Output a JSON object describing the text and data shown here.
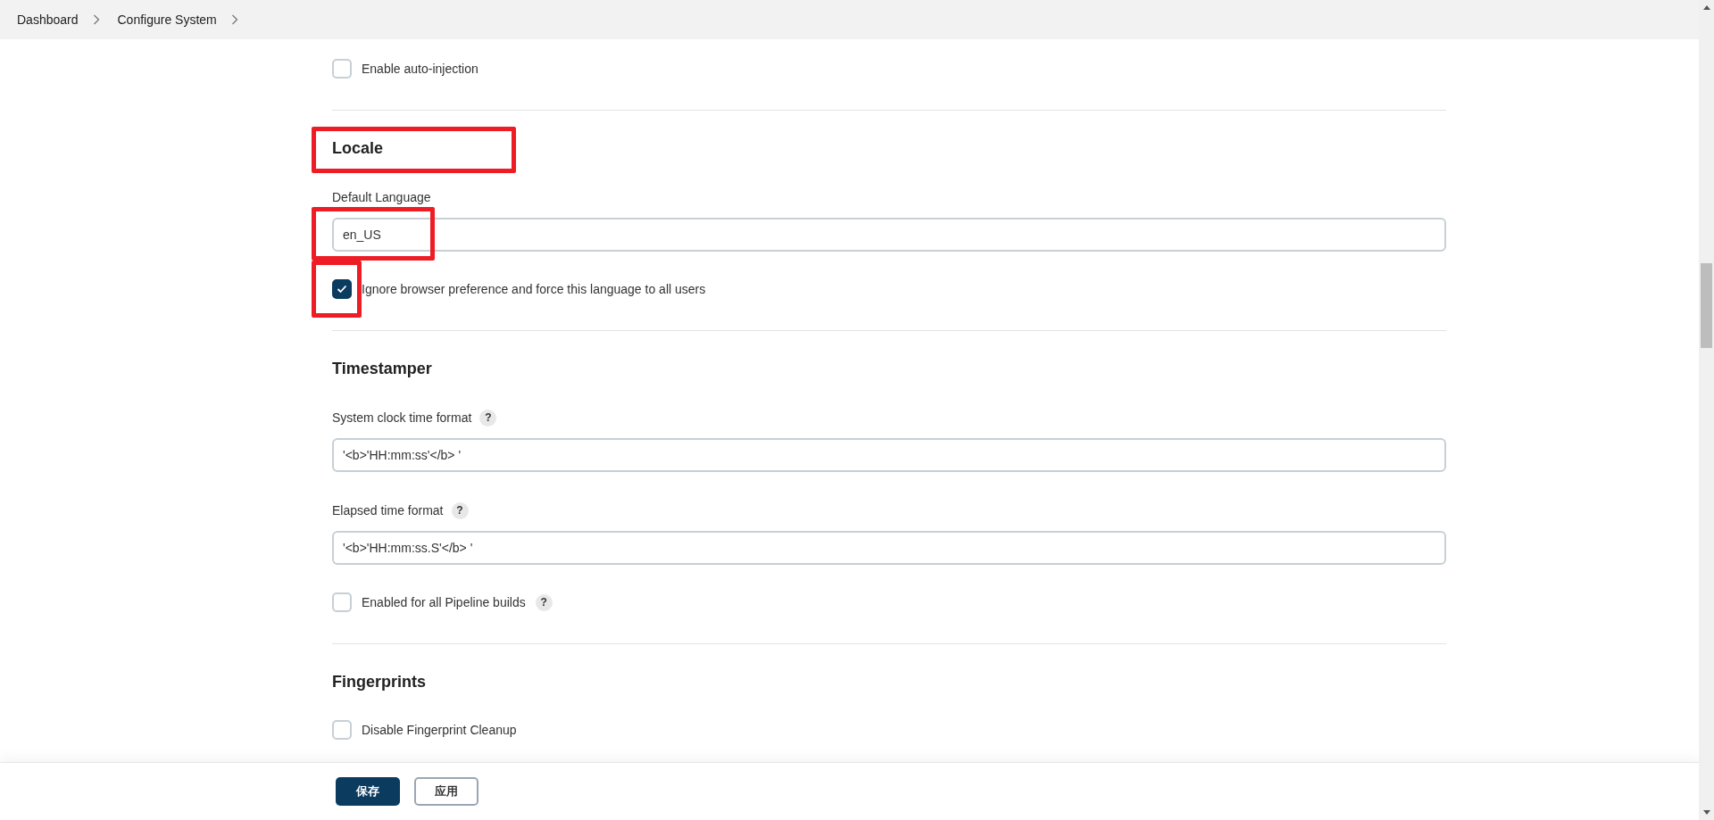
{
  "breadcrumbs": [
    {
      "label": "Dashboard"
    },
    {
      "label": "Configure System"
    }
  ],
  "sections": [
    {
      "items": [
        {
          "kind": "checkbox",
          "label": "Enable auto-injection",
          "checked": false
        }
      ]
    },
    {
      "title": "Locale",
      "highlighted": true,
      "items": [
        {
          "kind": "text",
          "label": "Default Language",
          "value": "en_US",
          "highlighted": true
        },
        {
          "kind": "checkbox",
          "label": "Ignore browser preference and force this language to all users",
          "checked": true,
          "highlighted": true
        }
      ]
    },
    {
      "title": "Timestamper",
      "items": [
        {
          "kind": "text",
          "label": "System clock time format",
          "value": "'<b>'HH:mm:ss'</b> '",
          "help": "?"
        },
        {
          "kind": "text",
          "label": "Elapsed time format",
          "value": "'<b>'HH:mm:ss.S'</b> '",
          "help": "?"
        },
        {
          "kind": "checkbox",
          "label": "Enabled for all Pipeline builds",
          "checked": false,
          "help": "?"
        }
      ]
    },
    {
      "title": "Fingerprints",
      "items": [
        {
          "kind": "checkbox",
          "label": "Disable Fingerprint Cleanup",
          "checked": false
        }
      ]
    }
  ],
  "buttons": [
    {
      "label": "保存",
      "primary": true
    },
    {
      "label": "应用",
      "primary": false
    }
  ]
}
